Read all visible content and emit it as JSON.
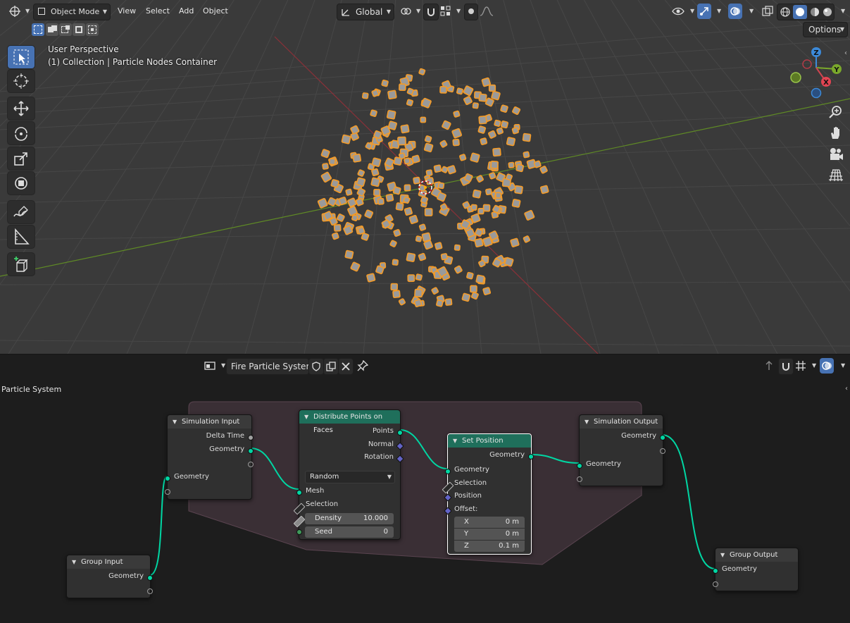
{
  "viewport": {
    "header": {
      "editor_type_icon": "orbit-icon",
      "mode_label": "Object Mode",
      "menus": [
        "View",
        "Select",
        "Add",
        "Object"
      ],
      "orientation_label": "Global",
      "options_label": "Options"
    },
    "overlay": {
      "perspective": "User Perspective",
      "collection": "(1) Collection | Particle Nodes Container"
    },
    "gizmo": {
      "x": "X",
      "y": "Y",
      "z": "Z"
    },
    "tools": [
      "select-box-icon",
      "cursor-icon",
      "move-icon",
      "rotate-icon",
      "scale-icon",
      "transform-icon",
      "annotate-icon",
      "measure-icon",
      "add-cube-icon"
    ],
    "nav": [
      "zoom-icon",
      "hand-icon",
      "camera-icon",
      "grid-icon"
    ]
  },
  "node_editor": {
    "header": {
      "tree_name": "Fire Particle System"
    },
    "breadcrumb": "Particle System",
    "nodes": {
      "simulation_input": {
        "title": "Simulation Input",
        "delta_time": "Delta Time",
        "geometry_out": "Geometry",
        "geometry_in": "Geometry"
      },
      "distribute": {
        "title": "Distribute Points on Faces",
        "points": "Points",
        "normal": "Normal",
        "rotation": "Rotation",
        "method": "Random",
        "mesh": "Mesh",
        "selection": "Selection",
        "density_label": "Density",
        "density_value": "10.000",
        "seed_label": "Seed",
        "seed_value": "0"
      },
      "set_position": {
        "title": "Set Position",
        "geometry_out": "Geometry",
        "geometry_in": "Geometry",
        "selection": "Selection",
        "position": "Position",
        "offset": "Offset:",
        "x_label": "X",
        "x_value": "0 m",
        "y_label": "Y",
        "y_value": "0 m",
        "z_label": "Z",
        "z_value": "0.1 m"
      },
      "simulation_output": {
        "title": "Simulation Output",
        "geometry_out": "Geometry",
        "geometry_in": "Geometry"
      },
      "group_input": {
        "title": "Group Input",
        "geometry": "Geometry"
      },
      "group_output": {
        "title": "Group Output",
        "geometry": "Geometry"
      }
    }
  },
  "colors": {
    "accent": "#4772b3",
    "geometry_socket": "#00d6a3",
    "node_header_green": "#1f6f5b",
    "particle_outline": "#f59b26",
    "x_axis": "#d04450",
    "y_axis": "#7aa82b",
    "z_axis": "#3c8ad9"
  }
}
